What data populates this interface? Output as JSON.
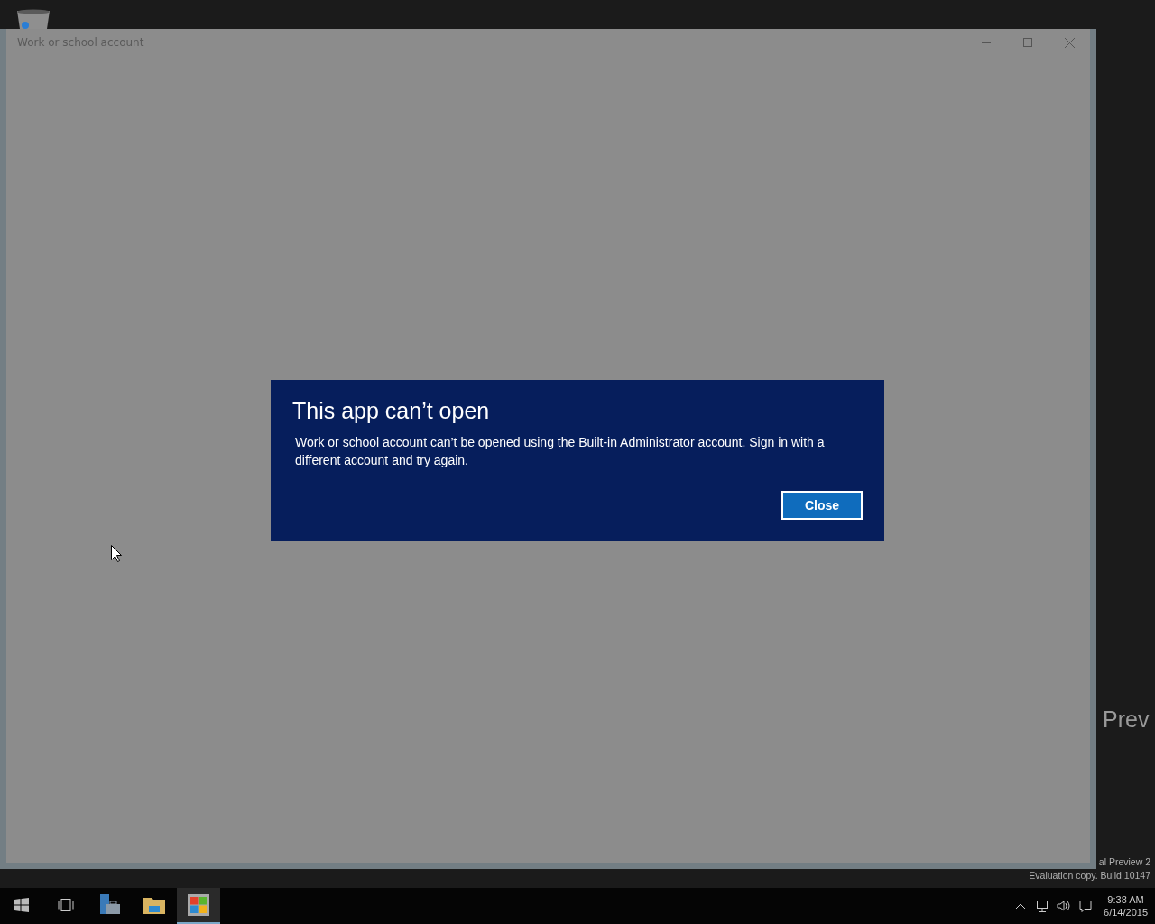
{
  "desktop": {
    "edge_text": "Prev",
    "build_lines": [
      "al Preview 2",
      "Evaluation copy. Build 10147"
    ]
  },
  "window": {
    "title": "Work or school account"
  },
  "dialog": {
    "title": "This app can’t open",
    "message": "Work or school account can’t be opened using the Built-in Administrator account. Sign in with a different account and try again.",
    "button": "Close"
  },
  "taskbar": {
    "items": [
      {
        "kind": "start",
        "selected": false
      },
      {
        "kind": "taskview",
        "selected": false
      },
      {
        "kind": "server",
        "selected": false
      },
      {
        "kind": "folder",
        "selected": false
      },
      {
        "kind": "store",
        "selected": true
      }
    ],
    "clock": {
      "time": "9:38 AM",
      "date": "6/14/2015"
    }
  }
}
